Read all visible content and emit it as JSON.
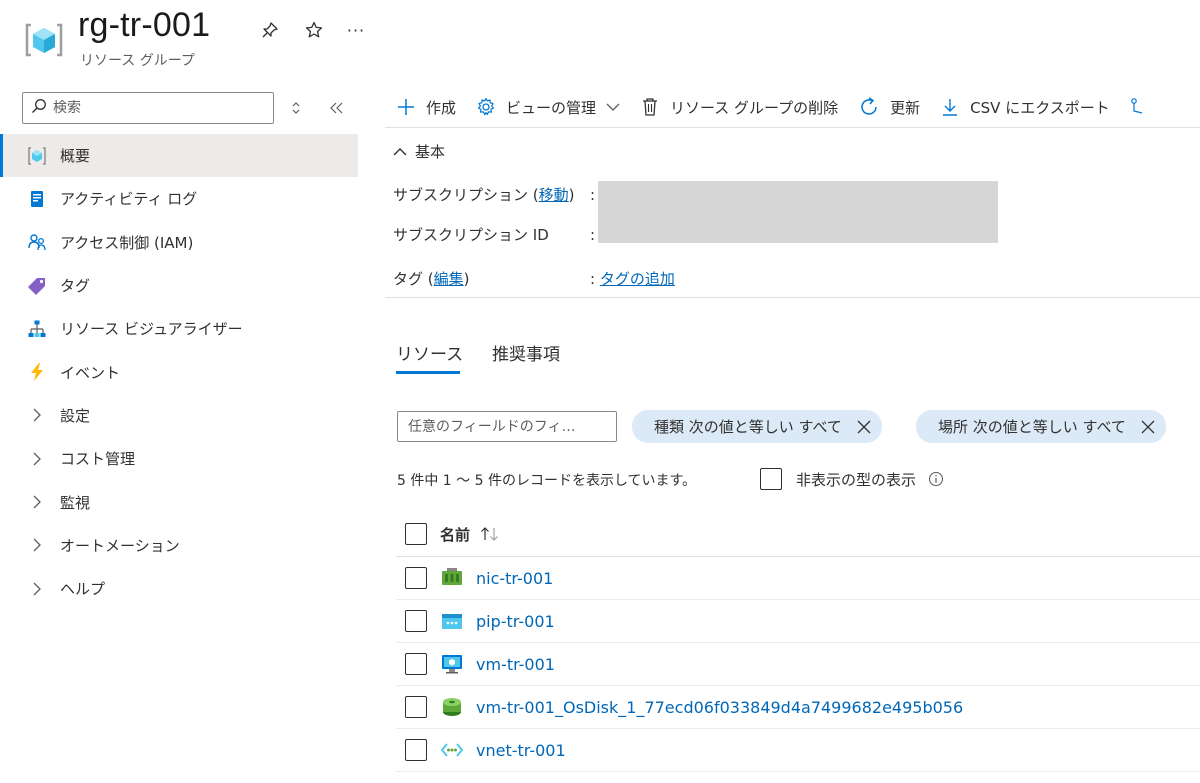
{
  "header": {
    "title": "rg-tr-001",
    "subtitle": "リソース グループ",
    "more_glyph": "···"
  },
  "nav": {
    "search_placeholder": "検索",
    "items": [
      {
        "label": "概要",
        "icon": "resource-group-icon",
        "active": true
      },
      {
        "label": "アクティビティ ログ",
        "icon": "activity-log-icon"
      },
      {
        "label": "アクセス制御 (IAM)",
        "icon": "iam-icon"
      },
      {
        "label": "タグ",
        "icon": "tag-icon"
      },
      {
        "label": "リソース ビジュアライザー",
        "icon": "visualizer-icon"
      },
      {
        "label": "イベント",
        "icon": "event-icon"
      },
      {
        "label": "設定",
        "icon": "chevron-right-icon"
      },
      {
        "label": "コスト管理",
        "icon": "chevron-right-icon"
      },
      {
        "label": "監視",
        "icon": "chevron-right-icon"
      },
      {
        "label": "オートメーション",
        "icon": "chevron-right-icon"
      },
      {
        "label": "ヘルプ",
        "icon": "chevron-right-icon"
      }
    ]
  },
  "toolbar": {
    "create": "作成",
    "manage_view": "ビューの管理",
    "delete_rg": "リソース グループの削除",
    "refresh": "更新",
    "export_csv": "CSV にエクスポート"
  },
  "essentials": {
    "heading": "基本",
    "subscription_label": "サブスクリプション (",
    "subscription_link": "移動",
    "subscription_label_end": ")",
    "subscription_id_label": "サブスクリプション ID",
    "tags_label": "タグ (",
    "tags_link": "編集",
    "tags_label_end": ")",
    "tags_value_link": "タグの追加",
    "colon": ":"
  },
  "tabs": {
    "resources": "リソース",
    "recommendations": "推奨事項"
  },
  "filter": {
    "placeholder": "任意のフィールドのフィ…",
    "pill_type": "種類 次の値と等しい すべて",
    "pill_location": "場所 次の値と等しい すべて"
  },
  "records": {
    "count_text": "5 件中 1 ～ 5 件のレコードを表示しています。",
    "show_hidden_types": "非表示の型の表示"
  },
  "grid": {
    "col_name": "名前",
    "rows": [
      {
        "name": "nic-tr-001",
        "icon": "network-interface-icon"
      },
      {
        "name": "pip-tr-001",
        "icon": "public-ip-icon"
      },
      {
        "name": "vm-tr-001",
        "icon": "virtual-machine-icon"
      },
      {
        "name": "vm-tr-001_OsDisk_1_77ecd06f033849d4a7499682e495b056",
        "icon": "disk-icon"
      },
      {
        "name": "vnet-tr-001",
        "icon": "virtual-network-icon"
      }
    ]
  },
  "colors": {
    "accent": "#0078d4",
    "link": "#0067b8",
    "pill_bg": "#dce9f7"
  }
}
